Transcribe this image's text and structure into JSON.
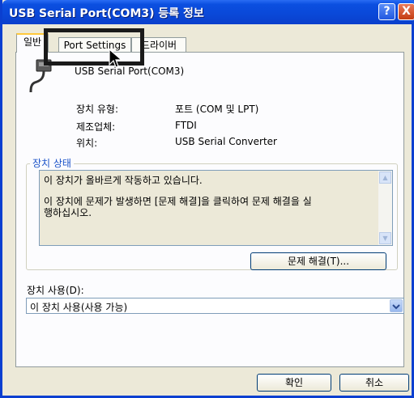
{
  "window": {
    "title": "USB Serial Port(COM3) 등록 정보",
    "help_label": "?",
    "close_label": "X"
  },
  "tabs": [
    {
      "label": "일반",
      "active": true
    },
    {
      "label": "Port Settings",
      "active": false
    },
    {
      "label": "드라이버",
      "active": false
    }
  ],
  "device": {
    "name": "USB Serial Port(COM3)",
    "fields": [
      {
        "label": "장치 유형:",
        "value": "포트 (COM 및 LPT)"
      },
      {
        "label": "제조업체:",
        "value": "FTDI"
      },
      {
        "label": "위치:",
        "value": "USB Serial Converter"
      }
    ]
  },
  "status_group": {
    "title": "장치 상태",
    "line1": "이 장치가 올바르게 작동하고 있습니다.",
    "line2": "이 장치에 문제가 발생하면 [문제 해결]을 클릭하여 문제 해결을 실",
    "line3": "행하십시오.",
    "troubleshoot_label": "문제 해결(T)..."
  },
  "usage": {
    "label": "장치 사용(D):",
    "selected": "이 장치 사용(사용 가능)"
  },
  "footer": {
    "ok_label": "확인",
    "cancel_label": "취소"
  },
  "colors": {
    "titlebar": "#0a48d8",
    "dialog_bg": "#ECE9D8",
    "group_title": "#1a52c8",
    "tab_accent": "#ffc83c"
  }
}
